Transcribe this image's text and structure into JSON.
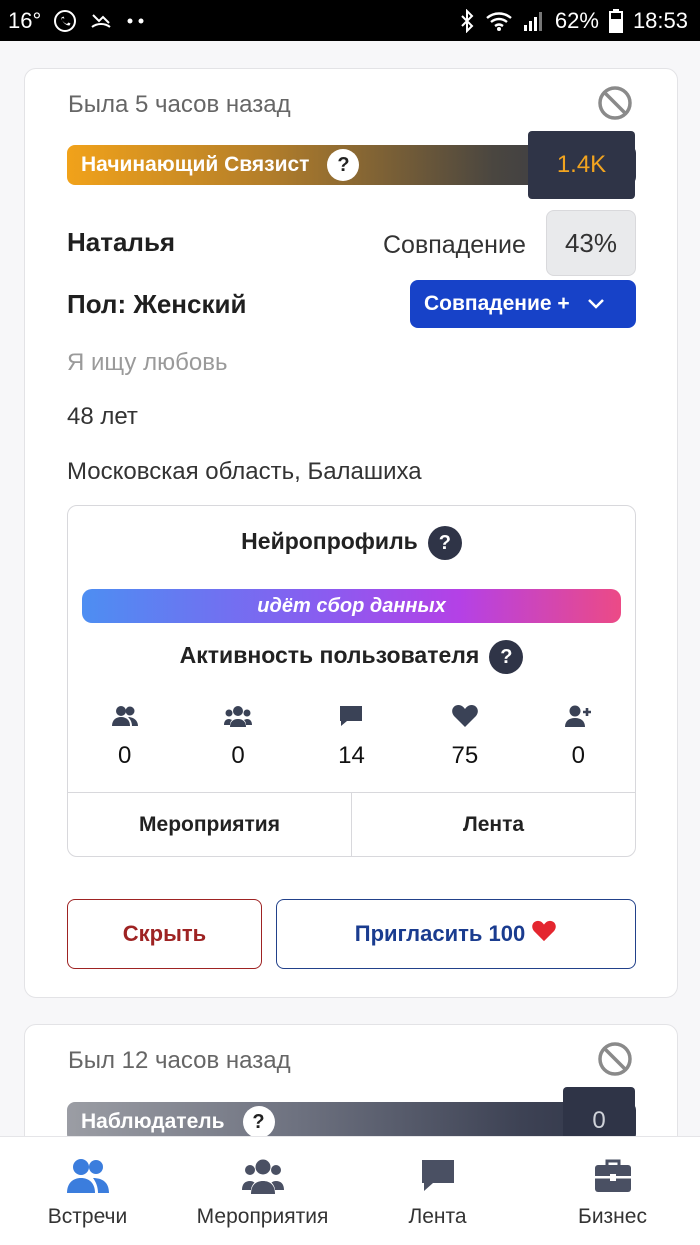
{
  "status_bar": {
    "temperature": "16°",
    "battery": "62%",
    "time": "18:53"
  },
  "profiles": [
    {
      "last_seen": "Была 5 часов назад",
      "level": {
        "title": "Начинающий Связист",
        "help": "?",
        "score": "1.4K"
      },
      "name": "Наталья",
      "match_label": "Совпадение",
      "match_value": "43%",
      "gender": "Пол: Женский",
      "match_plus_button": "Совпадение +",
      "seeking": "Я ищу любовь",
      "age": "48 лет",
      "location": "Московская область, Балашиха",
      "neuroprofile": {
        "title": "Нейропрофиль",
        "help": "?",
        "status": "идёт сбор данных",
        "activity_title": "Активность пользователя",
        "stats": [
          {
            "icon": "friends-icon",
            "value": "0"
          },
          {
            "icon": "group-icon",
            "value": "0"
          },
          {
            "icon": "comment-icon",
            "value": "14"
          },
          {
            "icon": "heart-icon",
            "value": "75"
          },
          {
            "icon": "add-user-icon",
            "value": "0"
          }
        ],
        "tabs": [
          "Мероприятия",
          "Лента"
        ]
      },
      "actions": {
        "hide": "Скрыть",
        "invite": "Пригласить 100",
        "invite_emoji": "❤️"
      }
    },
    {
      "last_seen": "Был 12 часов назад",
      "level": {
        "title": "Наблюдатель",
        "help": "?",
        "score": "0"
      }
    }
  ],
  "bottom_nav": [
    {
      "label": "Встречи",
      "icon": "users-icon",
      "active": true
    },
    {
      "label": "Мероприятия",
      "icon": "group-icon",
      "active": false
    },
    {
      "label": "Лента",
      "icon": "comment-icon",
      "active": false
    },
    {
      "label": "Бизнес",
      "icon": "briefcase-icon",
      "active": false
    }
  ],
  "colors": {
    "primary_blue": "#1742c8",
    "dark": "#2f3447",
    "score_orange": "#f2a41f",
    "hide_red": "#9e2323",
    "nav_active": "#3b7ddd"
  }
}
